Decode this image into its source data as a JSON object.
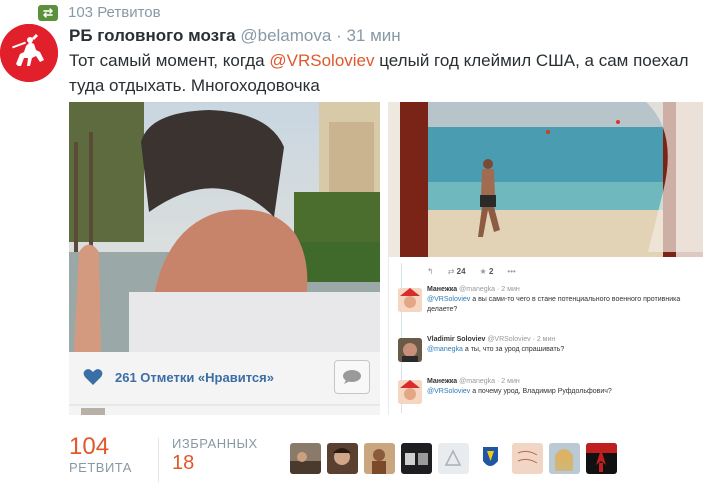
{
  "retweet_context": {
    "icon": "retweet-icon",
    "text": "103 Ретвитов",
    "icon_color": "#5c913b"
  },
  "tweet": {
    "author_name": "РБ головного мозга",
    "handle": "@belamova",
    "separator": "·",
    "time": "31 мин",
    "text_before": "Тот самый момент, когда ",
    "mention": "@VRSoloviev",
    "text_after": " целый год клеймил США, а сам поехал туда отдыхать. Многоходовочка",
    "accent_color": "#e0582c"
  },
  "instagram_card": {
    "likes_icon": "heart-icon",
    "likes_text": "261 Отметки «Нравится»",
    "comment_icon": "comment-icon",
    "partial_user": "s..."
  },
  "embedded_tweet": {
    "action_icons": [
      "reply-icon",
      "retweet-icon",
      "star-icon",
      "more-icon"
    ],
    "retweets": "24",
    "favorites": "2",
    "replies": [
      {
        "name": "Манежка",
        "handle": "@manegka",
        "time": "· 2 мин",
        "mention": "@VRSoloviev",
        "text": " а вы сами-то чего в стане потенциального военного противника делаете?"
      },
      {
        "name": "Vladimir Soloviev",
        "handle": "@VRSoloviev",
        "time": "· 2 мин",
        "mention": "@manegka",
        "text": " а ты, что за урод спрашивать?"
      },
      {
        "name": "Манежка",
        "handle": "@manegka",
        "time": "· 2 мин",
        "mention": "@VRSoloviev",
        "text": " а почему урод, Владимир Руфдольфович?"
      }
    ]
  },
  "stats": {
    "retweets_value": "104",
    "retweets_label": "РЕТВИТА",
    "favorites_label": "ИЗБРАННЫХ",
    "favorites_value": "18"
  },
  "favoriter_avatars": [
    "avatar-1",
    "avatar-2",
    "avatar-3",
    "avatar-4",
    "avatar-5",
    "avatar-6",
    "avatar-7",
    "avatar-8",
    "avatar-9"
  ]
}
